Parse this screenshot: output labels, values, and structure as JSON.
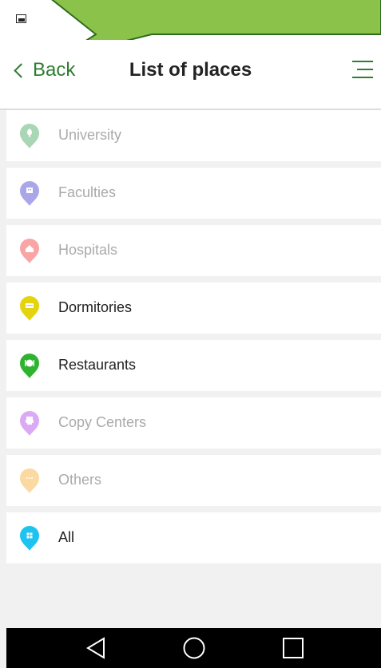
{
  "header": {
    "back_label": "Back",
    "title": "List of places"
  },
  "places": [
    {
      "label": "University",
      "color": "#a9d6b5",
      "enabled": false,
      "icon": "tree-icon"
    },
    {
      "label": "Faculties",
      "color": "#a9a7ea",
      "enabled": false,
      "icon": "building-icon"
    },
    {
      "label": "Hospitals",
      "color": "#f9a5a5",
      "enabled": false,
      "icon": "hospital-icon"
    },
    {
      "label": "Dormitories",
      "color": "#e4d410",
      "enabled": true,
      "icon": "bed-icon"
    },
    {
      "label": "Restaurants",
      "color": "#2fb32f",
      "enabled": true,
      "icon": "plate-icon"
    },
    {
      "label": "Copy Centers",
      "color": "#dca9f5",
      "enabled": false,
      "icon": "printer-icon"
    },
    {
      "label": "Others",
      "color": "#fbd9a3",
      "enabled": false,
      "icon": "dots-icon"
    },
    {
      "label": "All",
      "color": "#1ec3f0",
      "enabled": true,
      "icon": "grid-icon"
    }
  ],
  "colors": {
    "accent": "#2e7d32",
    "bubble": "#8bc34a"
  }
}
